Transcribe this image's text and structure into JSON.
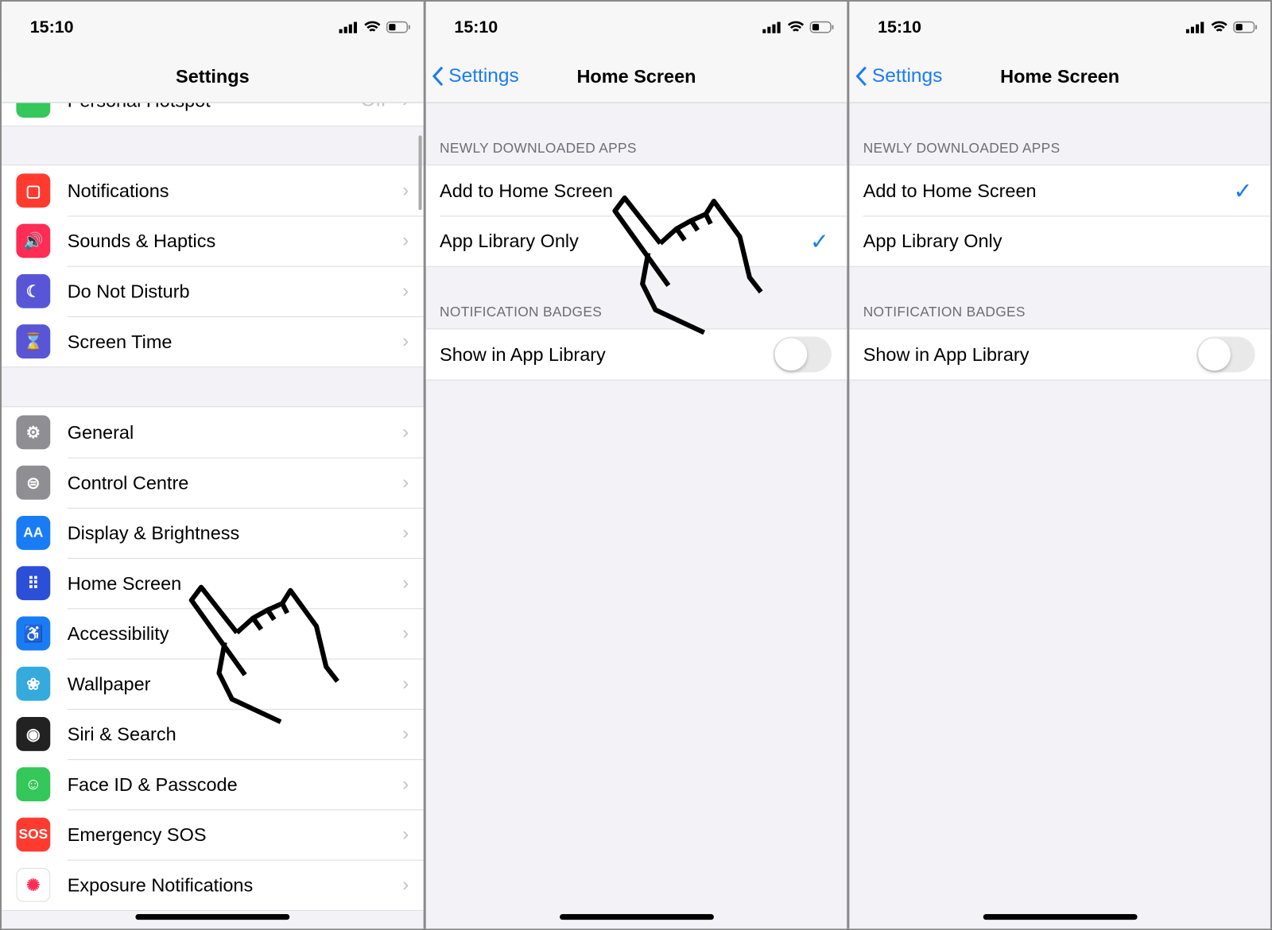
{
  "status_time": "15:10",
  "panel1": {
    "title": "Settings",
    "partial_top": {
      "label": "Personal Hotspot",
      "value": "Off",
      "color": "#34c759"
    },
    "group1": [
      {
        "label": "Notifications",
        "icon": "notifications-icon",
        "color": "#ff3b30"
      },
      {
        "label": "Sounds & Haptics",
        "icon": "speaker-icon",
        "color": "#ff2d55"
      },
      {
        "label": "Do Not Disturb",
        "icon": "moon-icon",
        "color": "#5856d6"
      },
      {
        "label": "Screen Time",
        "icon": "hourglass-icon",
        "color": "#5856d6"
      }
    ],
    "group2": [
      {
        "label": "General",
        "icon": "gear-icon",
        "color": "#8e8e93",
        "glyph": "⚙"
      },
      {
        "label": "Control Centre",
        "icon": "toggles-icon",
        "color": "#8e8e93",
        "glyph": "⊜"
      },
      {
        "label": "Display & Brightness",
        "icon": "text-size-icon",
        "color": "#1a7cf5",
        "glyph": "AA"
      },
      {
        "label": "Home Screen",
        "icon": "home-grid-icon",
        "color": "#2c4fd8",
        "glyph": "⠿"
      },
      {
        "label": "Accessibility",
        "icon": "accessibility-icon",
        "color": "#1a7cf5",
        "glyph": "♿"
      },
      {
        "label": "Wallpaper",
        "icon": "flower-icon",
        "color": "#35aadc",
        "glyph": "❀"
      },
      {
        "label": "Siri & Search",
        "icon": "siri-icon",
        "color": "#222",
        "glyph": "◉"
      },
      {
        "label": "Face ID & Passcode",
        "icon": "face-id-icon",
        "color": "#34c759",
        "glyph": "☺"
      },
      {
        "label": "Emergency SOS",
        "icon": "sos-icon",
        "color": "#ff3b30",
        "glyph": "SOS"
      },
      {
        "label": "Exposure Notifications",
        "icon": "exposure-icon",
        "color": "#ffffff",
        "glyph": "✺"
      }
    ]
  },
  "detail": {
    "back_label": "Settings",
    "title": "Home Screen",
    "section1": "NEWLY DOWNLOADED APPS",
    "option1": "Add to Home Screen",
    "option2": "App Library Only",
    "section2": "NOTIFICATION BADGES",
    "badge_option": "Show in App Library",
    "check_glyph": "✓"
  },
  "panel2_state": {
    "selected": "App Library Only",
    "show_in_app_library": false
  },
  "panel3_state": {
    "selected": "Add to Home Screen",
    "show_in_app_library": false
  },
  "accent": "#1a7cf5"
}
